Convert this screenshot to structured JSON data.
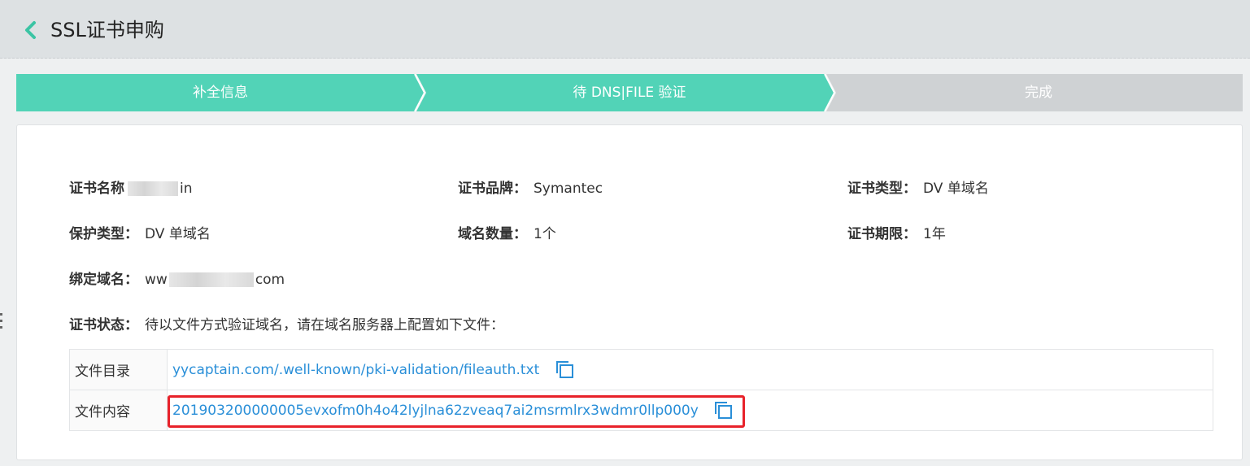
{
  "header": {
    "title": "SSL证书申购",
    "back_icon": "chevron-left-icon"
  },
  "steps": [
    {
      "label": "补全信息",
      "state": "done"
    },
    {
      "label": "待 DNS|FILE 验证",
      "state": "active"
    },
    {
      "label": "完成",
      "state": "pending"
    }
  ],
  "colors": {
    "step_active": "#52d3b7",
    "step_pending": "#cfd2d4",
    "link": "#2a8fd8",
    "highlight": "#e8222a"
  },
  "details": {
    "cert_name_label": "证书名称",
    "cert_name_value": "in",
    "brand_label": "证书品牌：",
    "brand_value": "Symantec",
    "type_label": "证书类型：",
    "type_value": "DV 单域名",
    "protect_label": "保护类型：",
    "protect_value": "DV 单域名",
    "domain_count_label": "域名数量：",
    "domain_count_value": "1个",
    "term_label": "证书期限：",
    "term_value": "1年",
    "bind_domain_label": "绑定域名：",
    "bind_domain_prefix": "ww",
    "bind_domain_suffix": "com",
    "status_label": "证书状态：",
    "status_value": "待以文件方式验证域名，请在域名服务器上配置如下文件："
  },
  "file_table": {
    "rows": [
      {
        "label": "文件目录",
        "value": "yycaptain.com/.well-known/pki-validation/fileauth.txt",
        "icon": "copy-icon"
      },
      {
        "label": "文件内容",
        "value": "201903200000005evxofm0h4o42lyjlna62zveaq7ai2msrmlrx3wdmr0llp000y",
        "icon": "copy-icon"
      }
    ]
  }
}
